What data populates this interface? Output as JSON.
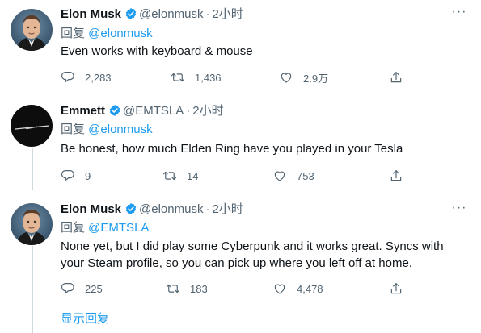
{
  "tweets": [
    {
      "name": "Elon Musk",
      "handle": "@elonmusk",
      "sep": "·",
      "time": "2小时",
      "reply_prefix": "回复 ",
      "reply_to": "@elonmusk",
      "text": "Even works with keyboard & mouse",
      "replies": "2,283",
      "retweets": "1,436",
      "likes": "2.9万"
    },
    {
      "name": "Emmett",
      "handle": "@EMTSLA",
      "sep": "·",
      "time": "2小时",
      "reply_prefix": "回复 ",
      "reply_to": "@elonmusk",
      "text": "Be honest, how much Elden Ring have you played in your Tesla",
      "replies": "9",
      "retweets": "14",
      "likes": "753"
    },
    {
      "name": "Elon Musk",
      "handle": "@elonmusk",
      "sep": "·",
      "time": "2小时",
      "reply_prefix": "回复 ",
      "reply_to": "@EMTSLA",
      "text": "None yet, but I did play some Cyberpunk and it works great. Syncs with your Steam profile, so you can pick up where you left off at home.",
      "replies": "225",
      "retweets": "183",
      "likes": "4,478"
    }
  ],
  "show_replies": "显示回复",
  "icons": {
    "verified": "verified-badge-icon",
    "more": "more-options-icon",
    "reply": "reply-icon",
    "retweet": "retweet-icon",
    "like": "like-icon",
    "share": "share-icon"
  },
  "colors": {
    "accent": "#1d9bf0",
    "secondary_text": "#536471",
    "primary_text": "#0f1419",
    "thread_line": "#cfd9de",
    "divider": "#eff3f4"
  }
}
